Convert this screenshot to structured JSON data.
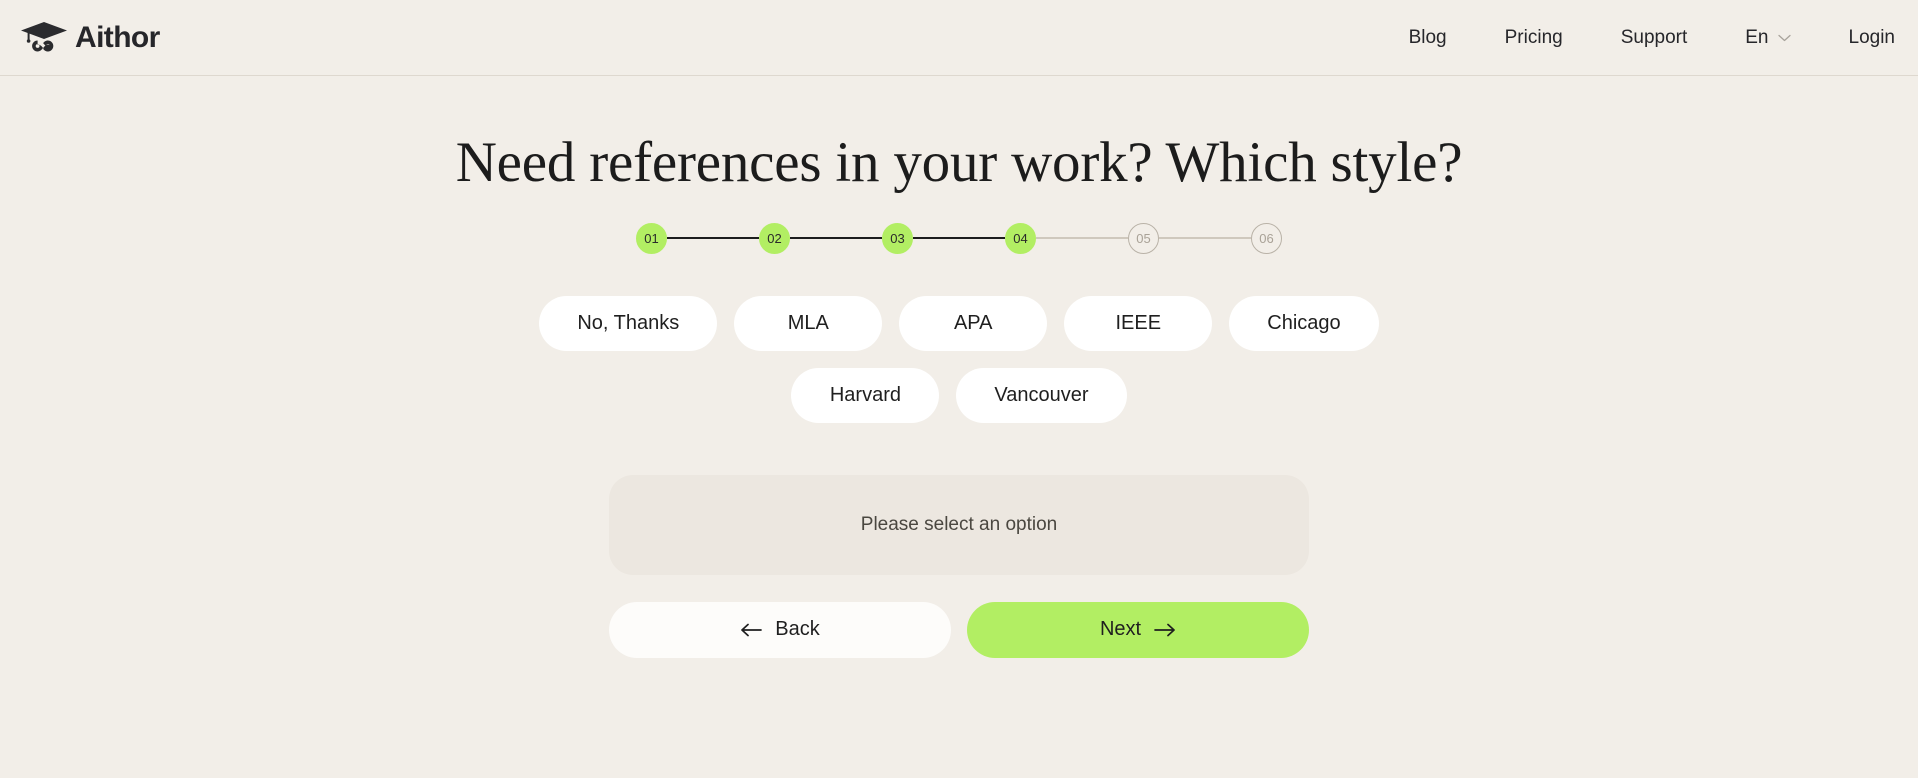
{
  "header": {
    "brand": {
      "name": "Aithor",
      "icon": "graduation-cap-infinity-logo"
    },
    "nav": [
      {
        "label": "Blog"
      },
      {
        "label": "Pricing"
      },
      {
        "label": "Support"
      }
    ],
    "language": {
      "label": "En",
      "icon": "chevron-down-icon"
    },
    "login": {
      "label": "Login"
    }
  },
  "main": {
    "title": "Need references in your work? Which style?",
    "stepper": {
      "steps": [
        {
          "label": "01",
          "state": "done"
        },
        {
          "label": "02",
          "state": "done"
        },
        {
          "label": "03",
          "state": "done"
        },
        {
          "label": "04",
          "state": "done"
        },
        {
          "label": "05",
          "state": "todo"
        },
        {
          "label": "06",
          "state": "todo"
        }
      ],
      "connectors": [
        "done",
        "done",
        "done",
        "todo",
        "todo"
      ]
    },
    "options": [
      {
        "label": "No, Thanks",
        "selected": false
      },
      {
        "label": "MLA",
        "selected": false
      },
      {
        "label": "APA",
        "selected": false
      },
      {
        "label": "IEEE",
        "selected": false
      },
      {
        "label": "Chicago",
        "selected": false
      },
      {
        "label": "Harvard",
        "selected": false
      },
      {
        "label": "Vancouver",
        "selected": false
      }
    ],
    "notice": "Please select an option",
    "actions": {
      "back": {
        "label": "Back",
        "icon": "arrow-left-icon"
      },
      "next": {
        "label": "Next",
        "icon": "arrow-right-icon"
      }
    }
  },
  "colors": {
    "page_background": "#f2eee8",
    "accent_green": "#b2ee63",
    "option_background": "#ffffff",
    "notice_background": "#ece7e0",
    "text_primary": "#1f1f1f",
    "step_inactive": "#b9b2a7"
  }
}
